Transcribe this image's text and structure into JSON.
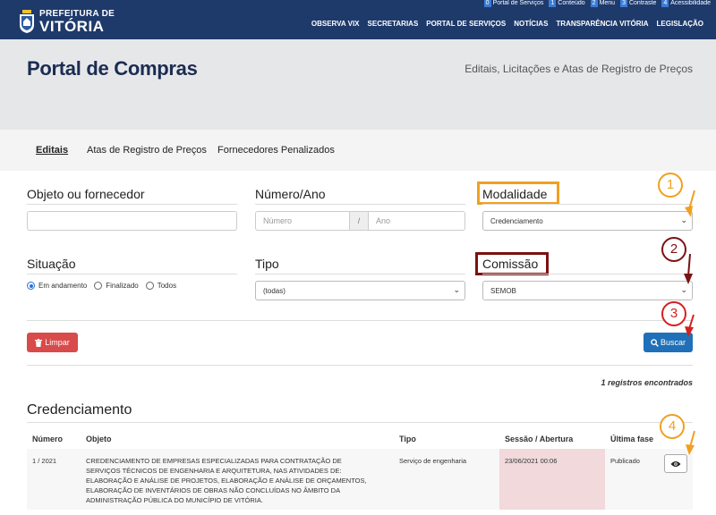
{
  "header": {
    "accessibility": [
      {
        "num": "0",
        "label": "Portal de Serviços"
      },
      {
        "num": "1",
        "label": "Conteúdo"
      },
      {
        "num": "2",
        "label": "Menu"
      },
      {
        "num": "3",
        "label": "Contraste"
      },
      {
        "num": "4",
        "label": "Acessibilidade"
      }
    ],
    "logo_line1": "PREFEITURA DE",
    "logo_line2": "VITÓRIA",
    "nav": [
      "OBSERVA VIX",
      "SECRETARIAS",
      "PORTAL DE SERVIÇOS",
      "NOTÍCIAS",
      "TRANSPARÊNCIA VITÓRIA",
      "LEGISLAÇÃO"
    ]
  },
  "hero": {
    "title": "Portal de Compras",
    "subtitle": "Editais, Licitações e Atas de Registro de Preços"
  },
  "tabs": [
    "Editais",
    "Atas de Registro de Preços",
    "Fornecedores Penalizados"
  ],
  "filters": {
    "objeto_label": "Objeto ou fornecedor",
    "numero_label": "Número/Ano",
    "numero_placeholder": "Número",
    "numero_sep": "/",
    "ano_placeholder": "Ano",
    "modalidade_label": "Modalidade",
    "modalidade_value": "Credenciamento",
    "situacao_label": "Situação",
    "situacao_options": [
      "Em andamento",
      "Finalizado",
      "Todos"
    ],
    "tipo_label": "Tipo",
    "tipo_value": "(todas)",
    "comissao_label": "Comissão",
    "comissao_value": "SEMOB"
  },
  "actions": {
    "limpar": "Limpar",
    "buscar": "Buscar"
  },
  "results": {
    "count_text": "1 registros encontrados",
    "section_title": "Credenciamento",
    "columns": [
      "Número",
      "Objeto",
      "Tipo",
      "Sessão / Abertura",
      "Última fase"
    ],
    "row": {
      "numero": "1 / 2021",
      "objeto_lines": [
        "CREDENCIAMENTO DE EMPRESAS ESPECIALIZADAS PARA CONTRATAÇÃO DE",
        "SERVIÇOS TÉCNICOS DE ENGENHARIA E ARQUITETURA, NAS ATIVIDADES DE:",
        "ELABORAÇÃO E ANÁLISE DE PROJETOS, ELABORAÇÃO E ANÁLISE DE ORÇAMENTOS,",
        "ELABORAÇÃO DE INVENTÁRIOS DE OBRAS NÃO CONCLUÍDAS NO ÂMBITO DA",
        "ADMINISTRAÇÃO PÚBLICA DO MUNICÍPIO DE VITÓRIA."
      ],
      "tipo": "Serviço de engenharia",
      "sessao": "23/06/2021 00:06",
      "ultima_fase": "Publicado"
    }
  },
  "annotations": [
    "1",
    "2",
    "3",
    "4"
  ],
  "colors": {
    "header_bg": "#1e3a6b",
    "hero_bg": "#e6e7e9",
    "title_color": "#1b2c52",
    "highlight_orange": "#f0a020",
    "highlight_dark_red": "#7a1212",
    "arrow_red": "#d42020",
    "buscar_bg": "#1f70b8",
    "limpar_bg": "#d94a4a",
    "session_cell_bg": "#f1d9dc"
  }
}
